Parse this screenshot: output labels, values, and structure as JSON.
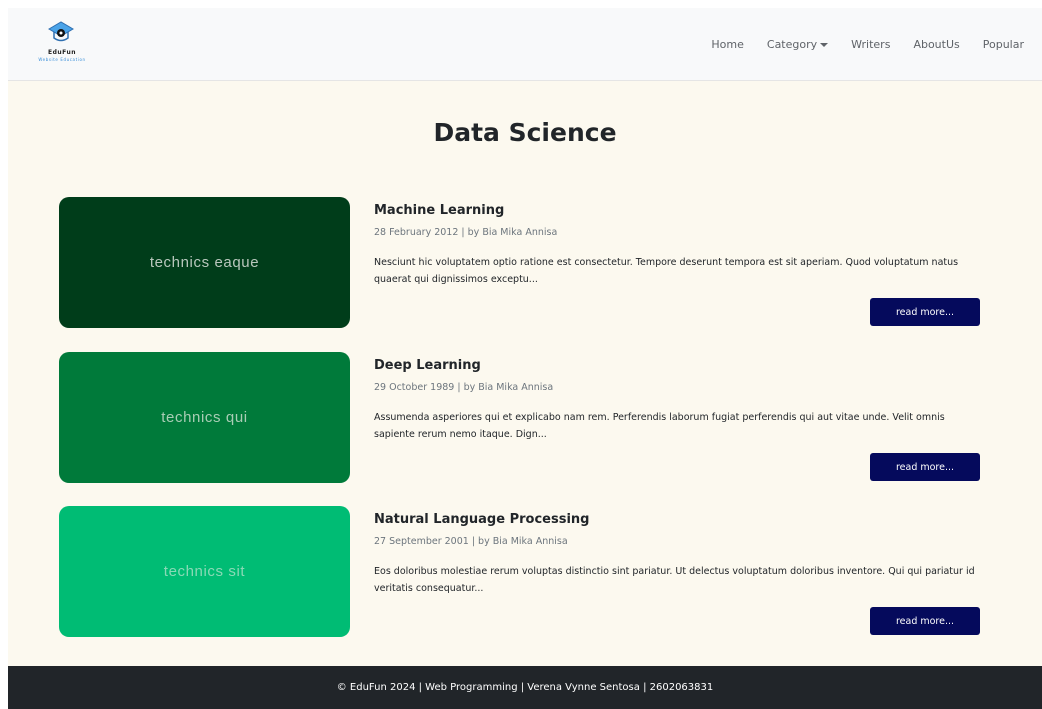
{
  "brand": {
    "name": "EduFun",
    "tagline": "Website Education"
  },
  "nav": {
    "items": [
      {
        "label": "Home"
      },
      {
        "label": "Category",
        "dropdown": true
      },
      {
        "label": "Writers"
      },
      {
        "label": "AboutUs"
      },
      {
        "label": "Popular"
      }
    ]
  },
  "page_title": "Data Science",
  "articles": [
    {
      "thumb_text": "technics eaque",
      "thumb_bg": "#003d1a",
      "thumb_fg": "#b9c7bd",
      "title": "Machine Learning",
      "meta": "28 February 2012 | by Bia Mika Annisa",
      "excerpt": "Nesciunt hic voluptatem optio ratione est consectetur. Tempore deserunt tempora est sit aperiam. Quod voluptatum natus quaerat qui dignissimos exceptu...",
      "button": "read more..."
    },
    {
      "thumb_text": "technics qui",
      "thumb_bg": "#007a3a",
      "thumb_fg": "#a9cdb5",
      "title": "Deep Learning",
      "meta": "29 October 1989 | by Bia Mika Annisa",
      "excerpt": "Assumenda asperiores qui et explicabo nam rem. Perferendis laborum fugiat perferendis qui aut vitae unde. Velit omnis sapiente rerum nemo itaque. Dign...",
      "button": "read more..."
    },
    {
      "thumb_text": "technics sit",
      "thumb_bg": "#00bc74",
      "thumb_fg": "#8ad9b6",
      "title": "Natural Language Processing",
      "meta": "27 September 2001 | by Bia Mika Annisa",
      "excerpt": "Eos doloribus molestiae rerum voluptas distinctio sint pariatur. Ut delectus voluptatum doloribus inventore. Qui qui pariatur id veritatis consequatur...",
      "button": "read more..."
    }
  ],
  "footer": {
    "text": "© EduFun 2024 | Web Programming | Verena Vynne Sentosa | 2602063831"
  },
  "colors": {
    "page_bg": "#fcf9ef",
    "navbar_bg": "#f8f9fa",
    "button_bg": "#050a5c",
    "footer_bg": "#212529"
  }
}
